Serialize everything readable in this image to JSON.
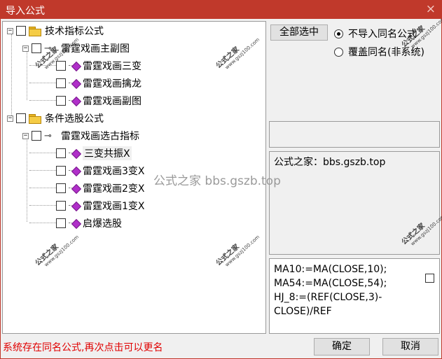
{
  "window": {
    "title": "导入公式",
    "close_glyph": "×"
  },
  "tree": {
    "groups": [
      {
        "label": "技术指标公式",
        "expander": "−",
        "children": [
          {
            "label": "雷霆戏画主副图",
            "expander": "−",
            "leaves": [
              "雷霆戏画三变",
              "雷霆戏画擒龙",
              "雷霆戏画副图"
            ]
          }
        ]
      },
      {
        "label": "条件选股公式",
        "expander": "−",
        "children": [
          {
            "label": "雷霆戏画选古指标",
            "expander": "−",
            "leaves": [
              "三变共振X",
              "雷霆戏画3变X",
              "雷霆戏画2变X",
              "雷霆戏画1变X",
              "启爆选股"
            ]
          }
        ]
      }
    ],
    "selected_leaf": "三变共振X"
  },
  "toolbar": {
    "select_all_label": "全部选中",
    "radio_options": [
      {
        "label": "不导入同名公式",
        "checked": true
      },
      {
        "label": "覆盖同名(非系统)",
        "checked": false
      }
    ]
  },
  "info_box": {
    "text": "公式之家：bbs.gszb.top"
  },
  "formula_box": {
    "text": "MA10:=MA(CLOSE,10);\nMA54:=MA(CLOSE,54);\nHJ_8:=(REF(CLOSE,3)-\nCLOSE)/REF"
  },
  "status": {
    "message": "系统存在同名公式,再次点击可以更名",
    "color": "#e00000"
  },
  "buttons": {
    "ok_label": "确定",
    "cancel_label": "取消"
  },
  "watermark": {
    "brand": "公式之家",
    "url": "www.gszj100.com",
    "center_text": "公式之家 bbs.gszb.top"
  },
  "colors": {
    "titlebar": "#c0392b",
    "item_icon": "#b02fc9"
  },
  "icons": {
    "folder": "folder-icon",
    "key": "key-icon",
    "item": "formula-item-icon"
  }
}
